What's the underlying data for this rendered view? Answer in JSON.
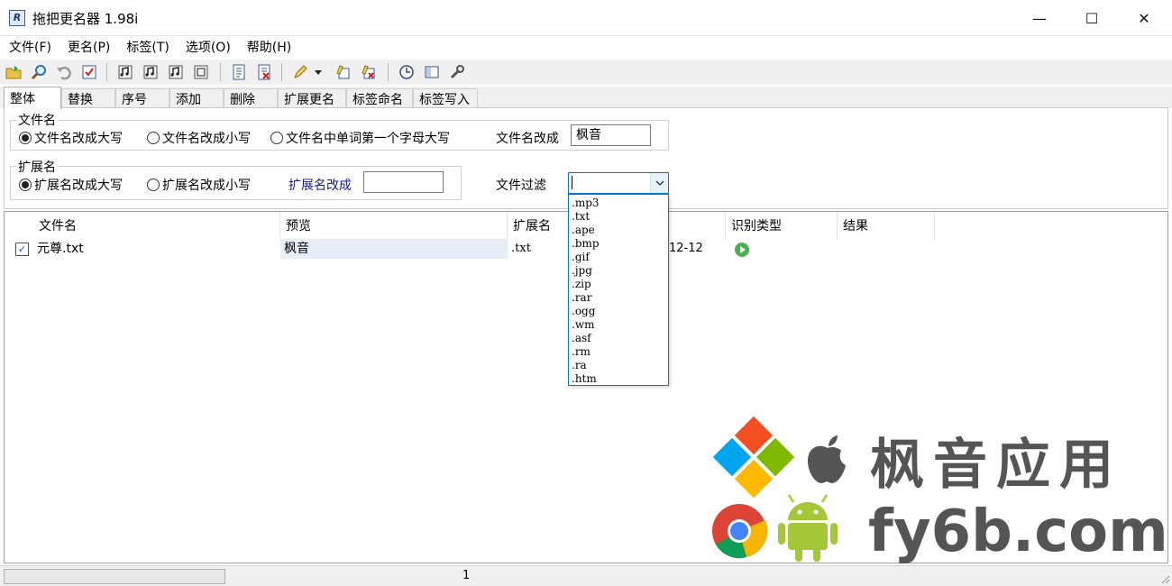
{
  "window": {
    "title": "拖把更名器 1.98i",
    "icon": "app-rename-icon",
    "min_glyph": "—",
    "max_glyph": "☐",
    "close_glyph": "✕"
  },
  "menu": [
    "文件(F)",
    "更名(P)",
    "标签(T)",
    "选项(O)",
    "帮助(H)"
  ],
  "toolbar": {
    "icons": [
      "add-folder-icon",
      "search-icon",
      "undo-icon",
      "check-icon",
      "music-tag-icon",
      "music-tag-2-icon",
      "music-tag-3-icon",
      "music-tag-4-icon",
      "document-icon",
      "document-delete-icon",
      "pen-icon",
      "dropdown-arrow-icon",
      "edit-icon",
      "edit-delete-icon",
      "clock-icon",
      "panel-icon",
      "tools-icon"
    ]
  },
  "tabs": [
    "整体",
    "替换",
    "序号",
    "添加",
    "删除",
    "扩展更名",
    "标签命名",
    "标签写入"
  ],
  "active_tab": 0,
  "filename_group": {
    "title": "文件名",
    "radios": [
      "文件名改成大写",
      "文件名改成小写",
      "文件名中单词第一个字母大写"
    ],
    "selected": 0,
    "rename_label": "文件名改成",
    "rename_value": "枫音"
  },
  "extension_group": {
    "title": "扩展名",
    "radios": [
      "扩展名改成大写",
      "扩展名改成小写"
    ],
    "selected": 0,
    "rename_label": "扩展名改成",
    "rename_value": ""
  },
  "filter": {
    "label": "文件过滤",
    "value": "",
    "options": [
      ".mp3",
      ".txt",
      ".ape",
      ".bmp",
      ".gif",
      ".jpg",
      ".zip",
      ".rar",
      ".ogg",
      ".wm",
      ".asf",
      ".rm",
      ".ra",
      ".htm"
    ]
  },
  "list": {
    "columns": [
      "文件名",
      "预览",
      "扩展名",
      "识别类型",
      "结果"
    ],
    "rows": [
      {
        "checked": true,
        "filename": "元尊.txt",
        "preview": "枫音",
        "ext": ".txt",
        "date": "12-12",
        "result": ""
      }
    ]
  },
  "watermark": {
    "brand": "枫音应用",
    "site": "fy6b.com"
  },
  "statusbar": {
    "count": "1"
  }
}
